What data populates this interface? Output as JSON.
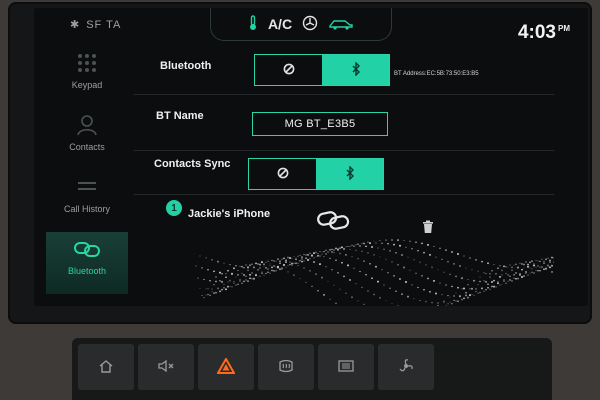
{
  "status": {
    "bt_symbol": "✱",
    "carrier": "SF TA",
    "climate_label": "A/C",
    "time": "4:03",
    "ampm": "PM"
  },
  "sidebar": {
    "items": [
      {
        "label": "Keypad",
        "icon": "keypad-icon",
        "active": false
      },
      {
        "label": "Contacts",
        "icon": "contacts-icon",
        "active": false
      },
      {
        "label": "Call History",
        "icon": "call-history-icon",
        "active": false
      },
      {
        "label": "Bluetooth",
        "icon": "bluetooth-link-icon",
        "active": true
      }
    ]
  },
  "settings": {
    "bluetooth": {
      "label": "Bluetooth",
      "state": "on",
      "address_text": "BT Address:EC:5B:73:50:E3:B5"
    },
    "bt_name": {
      "label": "BT Name",
      "value": "MG BT_E3B5"
    },
    "contacts_sync": {
      "label": "Contacts Sync",
      "state": "on"
    }
  },
  "device": {
    "index": "1",
    "name": "Jackie's iPhone",
    "link_icon": "link-icon",
    "delete_icon": "trash-icon"
  },
  "console": {
    "icons": [
      "home-icon",
      "volume-icon",
      "hazard-icon",
      "rear-defrost-icon",
      "front-defrost-icon",
      "fan-icon"
    ]
  },
  "colors": {
    "accent": "#22d1a6",
    "background": "#0c0d0e",
    "hazard": "#ff6a1a"
  }
}
